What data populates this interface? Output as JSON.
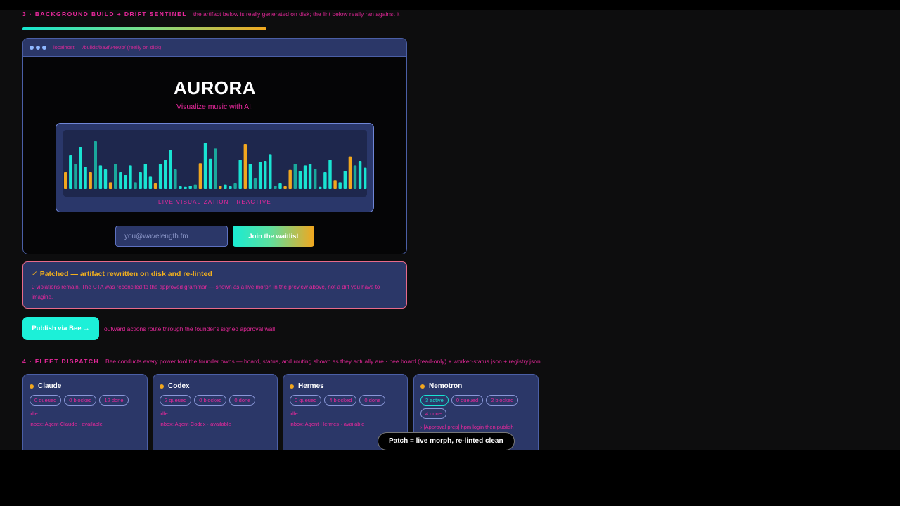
{
  "section3": {
    "title": "3 · BACKGROUND BUILD + DRIFT SENTINEL",
    "subtitle": "the artifact below is really generated on disk; the lint below really ran against it",
    "progress": 1.0
  },
  "preview": {
    "url": "localhost — /builds/ba3f24e0b/ (really on disk)",
    "hero_title": "AURORA",
    "hero_subtitle": "Visualize music with AI.",
    "viz_caption": "LIVE VISUALIZATION · REACTIVE",
    "viz_levels": [
      0.3,
      0.6,
      0.45,
      0.75,
      0.4,
      0.3,
      0.85,
      0.42,
      0.35,
      0.12,
      0.45,
      0.3,
      0.25,
      0.42,
      0.12,
      0.3,
      0.45,
      0.22,
      0.1,
      0.45,
      0.52,
      0.7,
      0.35,
      0.05,
      0.04,
      0.06,
      0.08,
      0.46,
      0.82,
      0.54,
      0.72,
      0.06,
      0.08,
      0.05,
      0.1,
      0.52,
      0.8,
      0.45,
      0.2,
      0.48,
      0.5,
      0.62,
      0.06,
      0.1,
      0.05,
      0.34,
      0.45,
      0.32,
      0.42,
      0.45,
      0.36,
      0.04,
      0.3,
      0.52,
      0.16,
      0.12,
      0.32,
      0.58,
      0.42,
      0.5,
      0.38
    ],
    "viz_colors": [
      "#19e3d2",
      "#f2a71e",
      "#1aa89c"
    ],
    "email_placeholder": "you@wavelength.fm",
    "cta_label": "Join the waitlist"
  },
  "patch": {
    "title": "✓ Patched — artifact rewritten on disk and re-linted",
    "body": "0 violations remain. The CTA was reconciled to the approved grammar — shown as a live morph in the preview above, not a diff you have to imagine."
  },
  "publish": {
    "button": "Publish via Bee →",
    "note": "outward actions route through the founder's signed approval wall"
  },
  "section4": {
    "title": "4 · FLEET DISPATCH",
    "subtitle": "Bee conducts every power tool the founder owns — board, status, and routing shown as they actually are · bee board (read-only) + worker-status.json + registry.json"
  },
  "agents": [
    {
      "name": "Claude",
      "pills": [
        "0 queued",
        "0 blocked",
        "12 done"
      ],
      "state": "idle",
      "inbox": "inbox: Agent-Claude · available"
    },
    {
      "name": "Codex",
      "pills": [
        "2 queued",
        "0 blocked",
        "0 done"
      ],
      "state": "idle",
      "inbox": "inbox: Agent-Codex · available"
    },
    {
      "name": "Hermes",
      "pills": [
        "0 queued",
        "4 blocked",
        "0 done"
      ],
      "state": "idle",
      "inbox": "inbox: Agent-Hermes · available"
    },
    {
      "name": "Nemotron",
      "pills": [
        "3 active",
        "0 queued",
        "2 blocked",
        "4 done"
      ],
      "task": "› [Approval prep] hpm login then publish"
    }
  ],
  "toast": "Patch = live morph, re-linted clean"
}
